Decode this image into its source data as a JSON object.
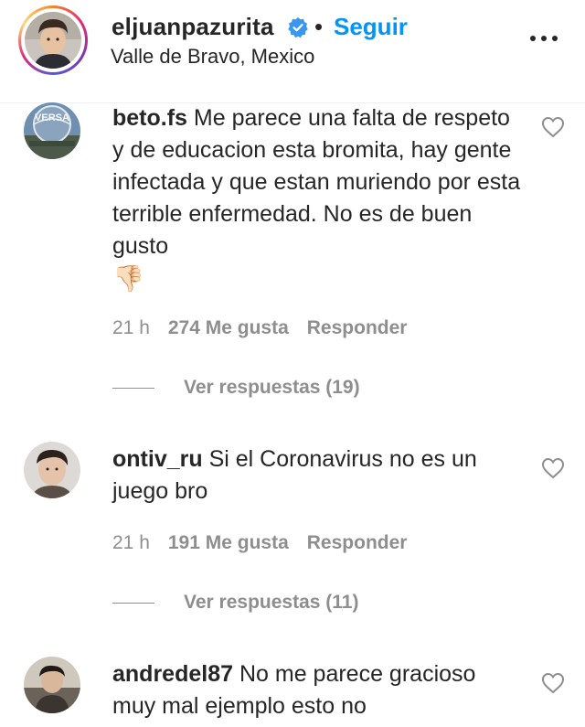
{
  "header": {
    "username": "eljuanpazurita",
    "separator": "•",
    "follow_label": "Seguir",
    "location": "Valle de Bravo, Mexico"
  },
  "comments": [
    {
      "username": "beto.fs",
      "text": "Me parece una falta de respeto y de educacion esta bromita, hay gente infectada y que estan muriendo por esta terrible enfermedad. No es de buen gusto",
      "emoji": "👎🏻",
      "avatar_text": "VERSA",
      "time": "21 h",
      "likes": "274 Me gusta",
      "reply_label": "Responder",
      "view_replies": "Ver respuestas (19)"
    },
    {
      "username": "ontiv_ru",
      "text": "Si el Coronavirus no es un juego bro",
      "time": "21 h",
      "likes": "191 Me gusta",
      "reply_label": "Responder",
      "view_replies": "Ver respuestas (11)"
    },
    {
      "username": "andredel87",
      "text": "No me parece gracioso muy mal ejemplo esto no"
    }
  ],
  "colors": {
    "text": "#262626",
    "secondary": "#8e8e8e",
    "link": "#0095f6",
    "verified": "#3897f0"
  }
}
